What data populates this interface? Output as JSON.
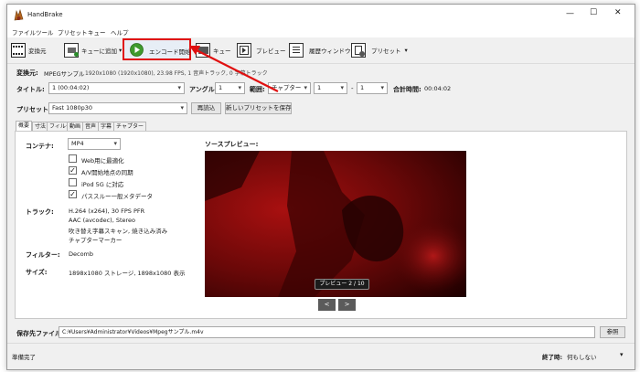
{
  "window": {
    "title": "HandBrake",
    "minimize": "—",
    "maximize": "☐",
    "close": "✕"
  },
  "menu": [
    "ファイル",
    "ツール",
    "プリセット",
    "キュー",
    "ヘルプ"
  ],
  "toolbar": {
    "source": "変換元",
    "add_queue": "キューに追加",
    "add_queue_arrow": "▾",
    "start": "エンコード開始",
    "queue": "キュー",
    "preview": "プレビュー",
    "activity": "履歴ウィンドウ",
    "presets": "プリセット",
    "presets_arrow": "▾"
  },
  "source_info": {
    "label": "変換元:",
    "name": "MPEGサンプル",
    "details": "1920x1080 (1920x1080), 23.98 FPS, 1 音声トラック, 0 字幕トラック"
  },
  "title_row": {
    "title_label": "タイトル:",
    "title_value": "1 (00:04:02)",
    "angle_label": "アングル:",
    "angle_value": "1",
    "range_label": "範囲:",
    "range_type": "チャプター",
    "range_start": "1",
    "range_dash": "-",
    "range_end": "1",
    "duration_label": "合計時間:",
    "duration_value": "00:04:02"
  },
  "preset_row": {
    "label": "プリセット:",
    "value": "Fast 1080p30",
    "reload": "再読込",
    "save_new": "新しいプリセットを保存"
  },
  "tabs": [
    "概要",
    "寸法",
    "フィルタ",
    "動画",
    "音声",
    "字幕",
    "チャプター"
  ],
  "summary": {
    "container_label": "コンテナ:",
    "container_value": "MP4",
    "web_optimized": "Web用に最適化",
    "av_sync": "A/V開始地点の同期",
    "ipod": "iPod 5G に対応",
    "passthru": "パススルー一般メタデータ",
    "checks": {
      "web_optimized": false,
      "av_sync": true,
      "ipod": false,
      "passthru": true
    },
    "tracks_label": "トラック:",
    "tracks": [
      "H.264 (x264), 30 FPS PFR",
      "AAC (avcodec), Stereo",
      "吹き替え字幕スキャン, 焼き込み済み",
      "チャプターマーカー"
    ],
    "filters_label": "フィルター:",
    "filters_value": "Decomb",
    "size_label": "サイズ:",
    "size_value": "1898x1080 ストレージ, 1898x1080 表示",
    "preview_label": "ソースプレビュー:",
    "preview_counter": "プレビュー 2 / 10",
    "prev_btn": "<",
    "next_btn": ">"
  },
  "output": {
    "label": "保存先ファイル:",
    "path": "C:¥Users¥Administrator¥Videos¥Mpegサンプル.m4v",
    "browse": "参照"
  },
  "status": {
    "left": "準備完了",
    "when_done_label": "終了時:",
    "when_done_value": "何もしない",
    "when_done_arrow": "▾"
  },
  "colors": {
    "highlight": "#e01010",
    "accent": "#2f7d1e",
    "window_bg": "#f0f0f0"
  }
}
